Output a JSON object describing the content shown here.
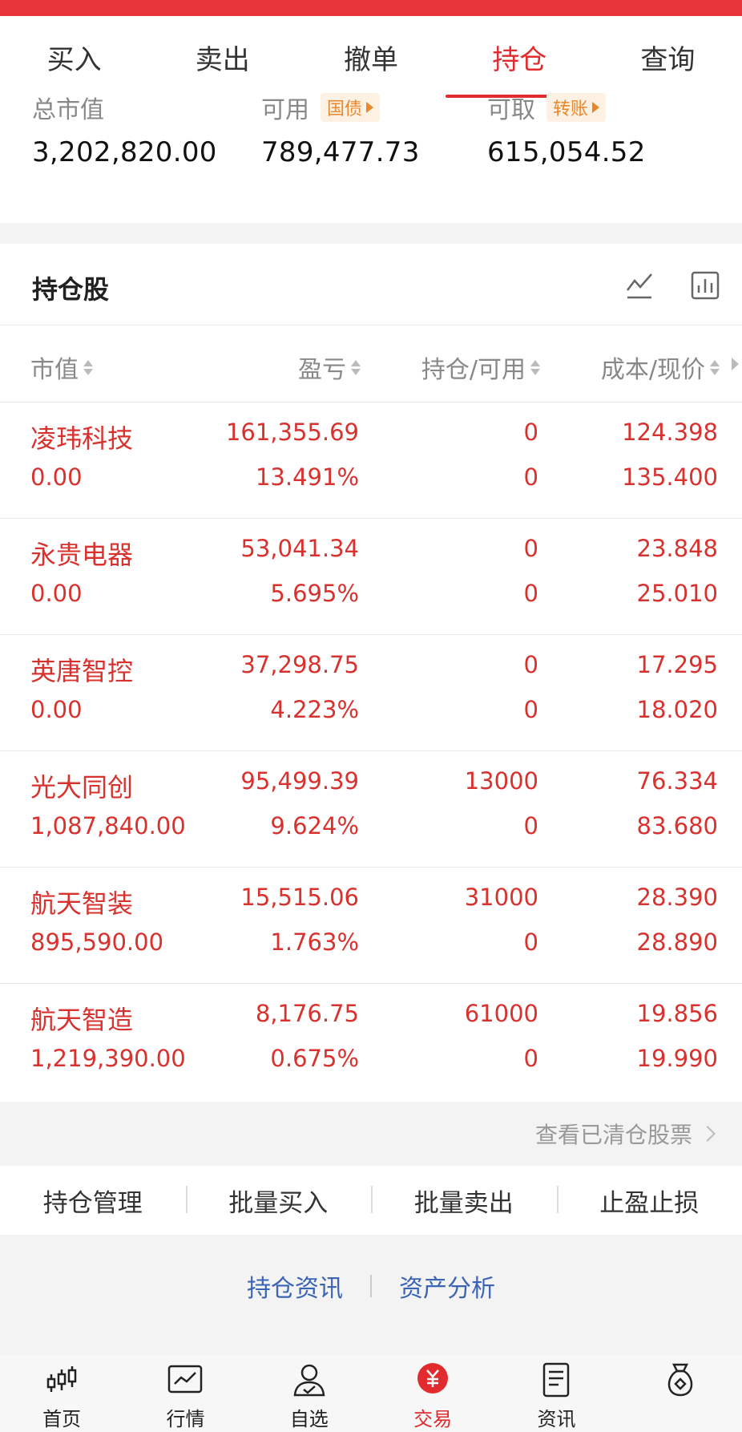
{
  "tabs": [
    {
      "label": "买入"
    },
    {
      "label": "卖出"
    },
    {
      "label": "撤单"
    },
    {
      "label": "持仓",
      "active": true
    },
    {
      "label": "查询"
    }
  ],
  "summary": {
    "total_label": "总市值",
    "total_value": "3,202,820.00",
    "available_label": "可用",
    "available_tag": "国债",
    "available_value": "789,477.73",
    "withdrawable_label": "可取",
    "withdrawable_tag": "转账",
    "withdrawable_value": "615,054.52"
  },
  "holdings_section": {
    "title": "持仓股",
    "icons": [
      "line-chart-icon",
      "bar-chart-icon"
    ]
  },
  "columns": {
    "market_value": "市值",
    "profit_loss": "盈亏",
    "holding_available": "持仓/可用",
    "cost_price": "成本/现价"
  },
  "rows": [
    {
      "name": "凌玮科技",
      "market_value": "0.00",
      "profit_loss": "161,355.69",
      "profit_pct": "13.491%",
      "holding": "0",
      "available": "0",
      "cost": "124.398",
      "price": "135.400"
    },
    {
      "name": "永贵电器",
      "market_value": "0.00",
      "profit_loss": "53,041.34",
      "profit_pct": "5.695%",
      "holding": "0",
      "available": "0",
      "cost": "23.848",
      "price": "25.010"
    },
    {
      "name": "英唐智控",
      "market_value": "0.00",
      "profit_loss": "37,298.75",
      "profit_pct": "4.223%",
      "holding": "0",
      "available": "0",
      "cost": "17.295",
      "price": "18.020"
    },
    {
      "name": "光大同创",
      "market_value": "1,087,840.00",
      "profit_loss": "95,499.39",
      "profit_pct": "9.624%",
      "holding": "13000",
      "available": "0",
      "cost": "76.334",
      "price": "83.680"
    },
    {
      "name": "航天智装",
      "market_value": "895,590.00",
      "profit_loss": "15,515.06",
      "profit_pct": "1.763%",
      "holding": "31000",
      "available": "0",
      "cost": "28.390",
      "price": "28.890"
    },
    {
      "name": "航天智造",
      "market_value": "1,219,390.00",
      "profit_loss": "8,176.75",
      "profit_pct": "0.675%",
      "holding": "61000",
      "available": "0",
      "cost": "19.856",
      "price": "19.990"
    }
  ],
  "cleared_link": "查看已清仓股票",
  "actions": [
    "持仓管理",
    "批量买入",
    "批量卖出",
    "止盈止损"
  ],
  "info_links": [
    "持仓资讯",
    "资产分析"
  ],
  "bottom_nav": [
    {
      "label": "首页",
      "icon": "candlestick-icon"
    },
    {
      "label": "行情",
      "icon": "market-chart-icon"
    },
    {
      "label": "自选",
      "icon": "user-check-icon"
    },
    {
      "label": "交易",
      "icon": "yuan-coin-icon",
      "active": true
    },
    {
      "label": "资讯",
      "icon": "document-icon"
    },
    {
      "label": "",
      "icon": "money-bag-icon"
    }
  ],
  "colors": {
    "accent": "#e12b2f",
    "gain": "#d8322f",
    "tag_orange": "#e8872b",
    "link_blue": "#3b64b5"
  }
}
